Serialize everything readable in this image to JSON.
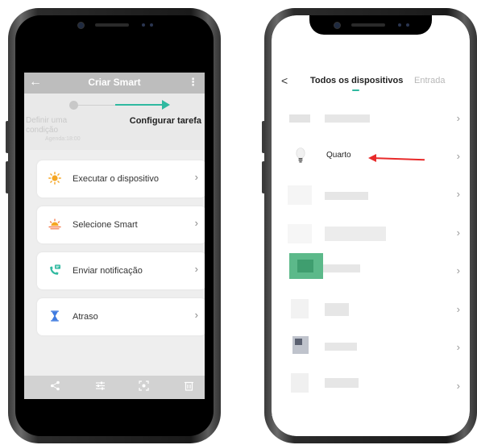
{
  "left": {
    "header": {
      "back": "←",
      "title": "Criar Smart",
      "more": "⋮"
    },
    "steps": {
      "step1": "Definir uma condição",
      "step1_sub": "Agenda:18:00",
      "step2": "Configurar tarefa"
    },
    "items": [
      {
        "label": "Executar o dispositivo",
        "icon": "sun-icon",
        "chev": "›"
      },
      {
        "label": "Selecione Smart",
        "icon": "sunrise-icon",
        "chev": "›"
      },
      {
        "label": "Enviar notificação",
        "icon": "phone-message-icon",
        "chev": "›"
      },
      {
        "label": "Atraso",
        "icon": "hourglass-icon",
        "chev": "›"
      }
    ],
    "colors": {
      "accent": "#2fb9a0",
      "sun": "#f5a623",
      "hourglass": "#3f7be0"
    }
  },
  "right": {
    "header": {
      "back": "<",
      "active_tab": "Todos os dispositivos",
      "next_tab": "Entrada"
    },
    "device_name": "Quarto",
    "chev": "›",
    "colors": {
      "arrow": "#e82a2a",
      "accent": "#2fb9a0"
    }
  }
}
